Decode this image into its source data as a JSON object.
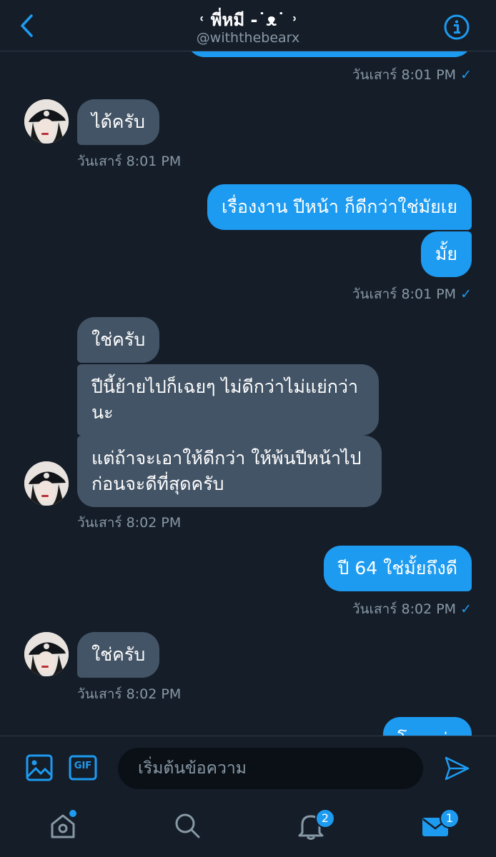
{
  "header": {
    "title": "˓ พี่หมี -˙ᴥ˙ ˒",
    "handle": "@withthebearx"
  },
  "messages": [
    {
      "id": "m0",
      "dir": "out",
      "text": "",
      "timestamp": "วันเสาร์ 8:01 PM",
      "read": true
    },
    {
      "id": "m1",
      "dir": "in",
      "text": "ได้ครับ",
      "timestamp": "วันเสาร์ 8:01 PM"
    },
    {
      "id": "m2",
      "dir": "out",
      "text": "เรื่องงาน ปีหน้า ก็ดีกว่าใช่มัยเย"
    },
    {
      "id": "m3",
      "dir": "out",
      "text": "มั้ย",
      "timestamp": "วันเสาร์ 8:01 PM",
      "read": true
    },
    {
      "id": "m4",
      "dir": "in",
      "text": "ใช่ครับ"
    },
    {
      "id": "m5",
      "dir": "in",
      "lines": [
        "ปีนี้ย้ายไปก็เฉยๆ ไม่ดีกว่าไม่แย่กว่า",
        "นะ"
      ]
    },
    {
      "id": "m6",
      "dir": "in",
      "lines": [
        "แต่ถ้าจะเอาให้ดีกว่า ให้พ้นปีหน้าไป",
        "ก่อนจะดีที่สุดครับ"
      ],
      "timestamp": "วันเสาร์ 8:02 PM"
    },
    {
      "id": "m7",
      "dir": "out",
      "text": "ปี 64 ใช่มั้ยถึงดี",
      "timestamp": "วันเสาร์ 8:02 PM",
      "read": true
    },
    {
      "id": "m8",
      "dir": "in",
      "text": "ใช่ครับ",
      "timestamp": "วันเสาร์ 8:02 PM"
    },
    {
      "id": "m9",
      "dir": "out",
      "text": "โอเคค่ะ"
    }
  ],
  "read_mark": "✓",
  "composer": {
    "placeholder": "เริ่มต้นข้อความ",
    "gif_label": "GIF"
  },
  "tabbar": {
    "notifications_badge": "2",
    "messages_badge": "1"
  },
  "colors": {
    "background": "#151d29",
    "accent": "#1d9bf0",
    "incoming_bubble": "#435466",
    "muted_text": "#8899a6"
  },
  "icons": [
    "back-chevron-icon",
    "info-icon",
    "image-icon",
    "gif-icon",
    "send-icon",
    "home-icon",
    "search-icon",
    "bell-icon",
    "mail-icon"
  ]
}
